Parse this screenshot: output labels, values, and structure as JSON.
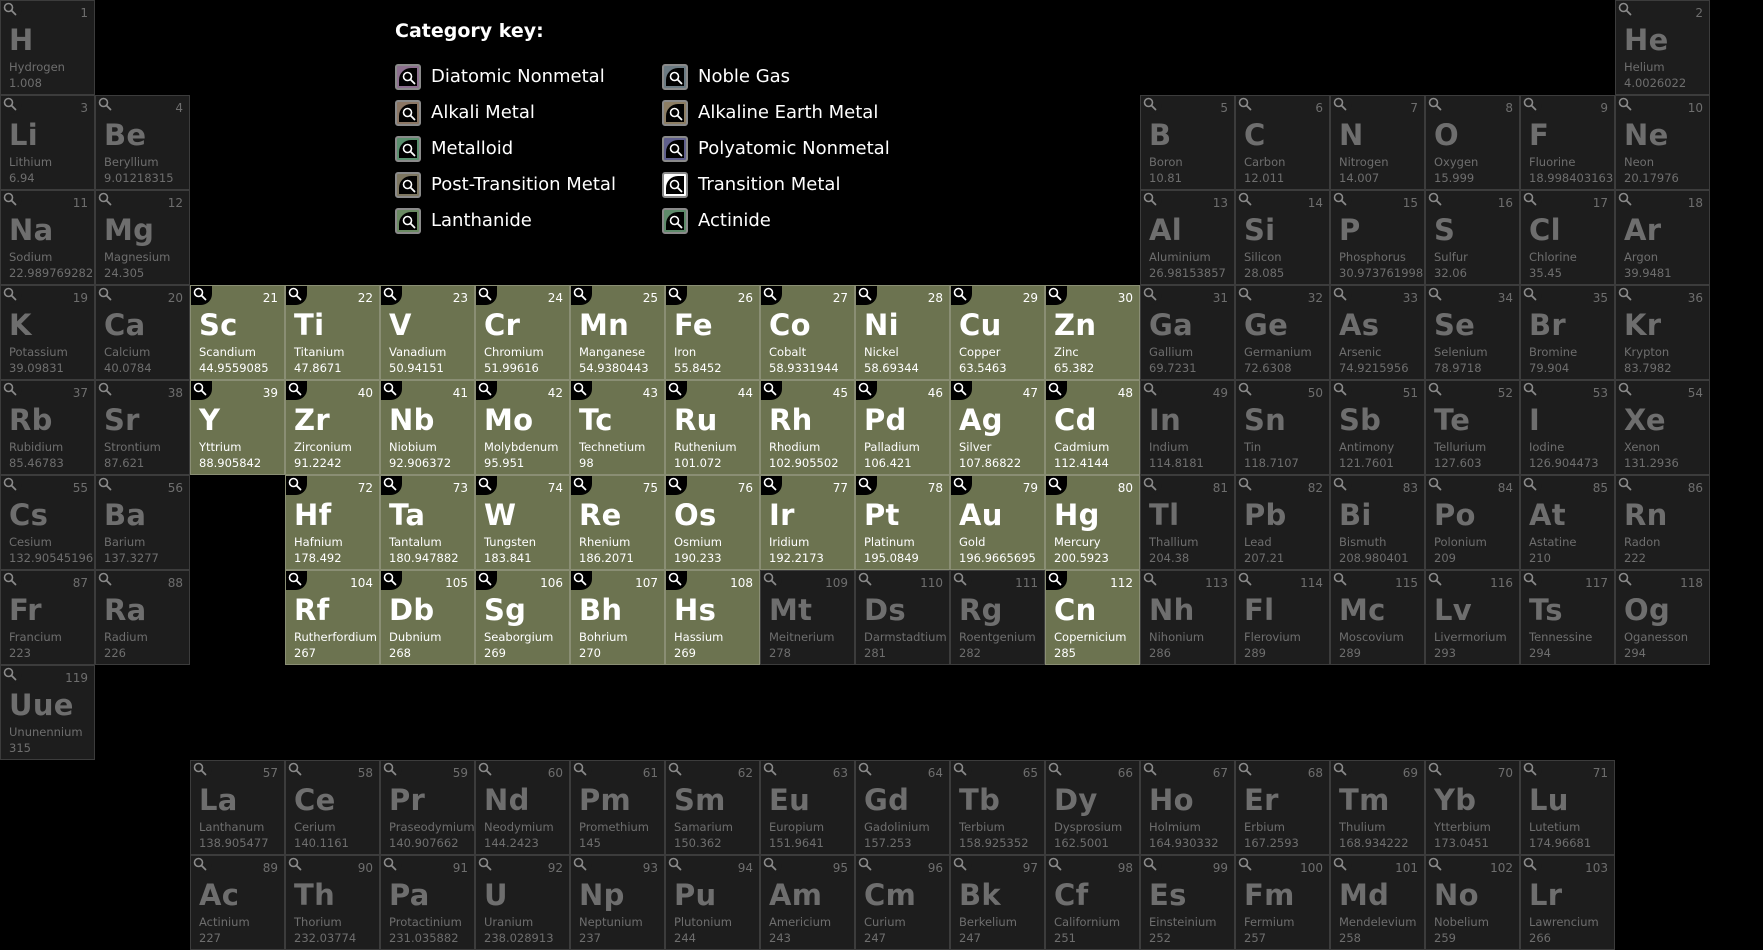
{
  "legend": {
    "title": "Category key:",
    "items": [
      {
        "label": "Diatomic Nonmetal",
        "color": "#8c6f8e"
      },
      {
        "label": "Noble Gas",
        "color": "#6b7a82"
      },
      {
        "label": "Alkali Metal",
        "color": "#8b7664"
      },
      {
        "label": "Alkaline Earth Metal",
        "color": "#8c7d63"
      },
      {
        "label": "Metalloid",
        "color": "#5a8f6e"
      },
      {
        "label": "Polyatomic Nonmetal",
        "color": "#5f5f8c"
      },
      {
        "label": "Post-Transition Metal",
        "color": "#7d7660"
      },
      {
        "label": "Transition Metal",
        "color": "#ffffff"
      },
      {
        "label": "Lanthanide",
        "color": "#6a8a62"
      },
      {
        "label": "Actinide",
        "color": "#5e8a6a"
      }
    ]
  },
  "colors": {
    "highlight_cell": "#6c7350",
    "dim_cell": "#1d1d1d",
    "dim_text": "#6e6e6e"
  },
  "icons": {
    "cell_corner": "magnifier-icon",
    "legend_box": "magnifier-icon"
  },
  "elements": [
    {
      "n": 1,
      "sym": "H",
      "name": "Hydrogen",
      "w": "1.008",
      "row": 1,
      "col": 1,
      "hl": false
    },
    {
      "n": 2,
      "sym": "He",
      "name": "Helium",
      "w": "4.0026022",
      "row": 1,
      "col": 18,
      "hl": false
    },
    {
      "n": 3,
      "sym": "Li",
      "name": "Lithium",
      "w": "6.94",
      "row": 2,
      "col": 1,
      "hl": false
    },
    {
      "n": 4,
      "sym": "Be",
      "name": "Beryllium",
      "w": "9.01218315",
      "row": 2,
      "col": 2,
      "hl": false
    },
    {
      "n": 5,
      "sym": "B",
      "name": "Boron",
      "w": "10.81",
      "row": 2,
      "col": 13,
      "hl": false
    },
    {
      "n": 6,
      "sym": "C",
      "name": "Carbon",
      "w": "12.011",
      "row": 2,
      "col": 14,
      "hl": false
    },
    {
      "n": 7,
      "sym": "N",
      "name": "Nitrogen",
      "w": "14.007",
      "row": 2,
      "col": 15,
      "hl": false
    },
    {
      "n": 8,
      "sym": "O",
      "name": "Oxygen",
      "w": "15.999",
      "row": 2,
      "col": 16,
      "hl": false
    },
    {
      "n": 9,
      "sym": "F",
      "name": "Fluorine",
      "w": "18.9984031636",
      "row": 2,
      "col": 17,
      "hl": false
    },
    {
      "n": 10,
      "sym": "Ne",
      "name": "Neon",
      "w": "20.17976",
      "row": 2,
      "col": 18,
      "hl": false
    },
    {
      "n": 11,
      "sym": "Na",
      "name": "Sodium",
      "w": "22.989769282",
      "row": 3,
      "col": 1,
      "hl": false
    },
    {
      "n": 12,
      "sym": "Mg",
      "name": "Magnesium",
      "w": "24.305",
      "row": 3,
      "col": 2,
      "hl": false
    },
    {
      "n": 13,
      "sym": "Al",
      "name": "Aluminium",
      "w": "26.98153857",
      "row": 3,
      "col": 13,
      "hl": false
    },
    {
      "n": 14,
      "sym": "Si",
      "name": "Silicon",
      "w": "28.085",
      "row": 3,
      "col": 14,
      "hl": false
    },
    {
      "n": 15,
      "sym": "P",
      "name": "Phosphorus",
      "w": "30.9737619985",
      "row": 3,
      "col": 15,
      "hl": false
    },
    {
      "n": 16,
      "sym": "S",
      "name": "Sulfur",
      "w": "32.06",
      "row": 3,
      "col": 16,
      "hl": false
    },
    {
      "n": 17,
      "sym": "Cl",
      "name": "Chlorine",
      "w": "35.45",
      "row": 3,
      "col": 17,
      "hl": false
    },
    {
      "n": 18,
      "sym": "Ar",
      "name": "Argon",
      "w": "39.9481",
      "row": 3,
      "col": 18,
      "hl": false
    },
    {
      "n": 19,
      "sym": "K",
      "name": "Potassium",
      "w": "39.09831",
      "row": 4,
      "col": 1,
      "hl": false
    },
    {
      "n": 20,
      "sym": "Ca",
      "name": "Calcium",
      "w": "40.0784",
      "row": 4,
      "col": 2,
      "hl": false
    },
    {
      "n": 21,
      "sym": "Sc",
      "name": "Scandium",
      "w": "44.9559085",
      "row": 4,
      "col": 3,
      "hl": true
    },
    {
      "n": 22,
      "sym": "Ti",
      "name": "Titanium",
      "w": "47.8671",
      "row": 4,
      "col": 4,
      "hl": true
    },
    {
      "n": 23,
      "sym": "V",
      "name": "Vanadium",
      "w": "50.94151",
      "row": 4,
      "col": 5,
      "hl": true
    },
    {
      "n": 24,
      "sym": "Cr",
      "name": "Chromium",
      "w": "51.99616",
      "row": 4,
      "col": 6,
      "hl": true
    },
    {
      "n": 25,
      "sym": "Mn",
      "name": "Manganese",
      "w": "54.9380443",
      "row": 4,
      "col": 7,
      "hl": true
    },
    {
      "n": 26,
      "sym": "Fe",
      "name": "Iron",
      "w": "55.8452",
      "row": 4,
      "col": 8,
      "hl": true
    },
    {
      "n": 27,
      "sym": "Co",
      "name": "Cobalt",
      "w": "58.9331944",
      "row": 4,
      "col": 9,
      "hl": true
    },
    {
      "n": 28,
      "sym": "Ni",
      "name": "Nickel",
      "w": "58.69344",
      "row": 4,
      "col": 10,
      "hl": true
    },
    {
      "n": 29,
      "sym": "Cu",
      "name": "Copper",
      "w": "63.5463",
      "row": 4,
      "col": 11,
      "hl": true
    },
    {
      "n": 30,
      "sym": "Zn",
      "name": "Zinc",
      "w": "65.382",
      "row": 4,
      "col": 12,
      "hl": true
    },
    {
      "n": 31,
      "sym": "Ga",
      "name": "Gallium",
      "w": "69.7231",
      "row": 4,
      "col": 13,
      "hl": false
    },
    {
      "n": 32,
      "sym": "Ge",
      "name": "Germanium",
      "w": "72.6308",
      "row": 4,
      "col": 14,
      "hl": false
    },
    {
      "n": 33,
      "sym": "As",
      "name": "Arsenic",
      "w": "74.9215956",
      "row": 4,
      "col": 15,
      "hl": false
    },
    {
      "n": 34,
      "sym": "Se",
      "name": "Selenium",
      "w": "78.9718",
      "row": 4,
      "col": 16,
      "hl": false
    },
    {
      "n": 35,
      "sym": "Br",
      "name": "Bromine",
      "w": "79.904",
      "row": 4,
      "col": 17,
      "hl": false
    },
    {
      "n": 36,
      "sym": "Kr",
      "name": "Krypton",
      "w": "83.7982",
      "row": 4,
      "col": 18,
      "hl": false
    },
    {
      "n": 37,
      "sym": "Rb",
      "name": "Rubidium",
      "w": "85.46783",
      "row": 5,
      "col": 1,
      "hl": false
    },
    {
      "n": 38,
      "sym": "Sr",
      "name": "Strontium",
      "w": "87.621",
      "row": 5,
      "col": 2,
      "hl": false
    },
    {
      "n": 39,
      "sym": "Y",
      "name": "Yttrium",
      "w": "88.905842",
      "row": 5,
      "col": 3,
      "hl": true
    },
    {
      "n": 40,
      "sym": "Zr",
      "name": "Zirconium",
      "w": "91.2242",
      "row": 5,
      "col": 4,
      "hl": true
    },
    {
      "n": 41,
      "sym": "Nb",
      "name": "Niobium",
      "w": "92.906372",
      "row": 5,
      "col": 5,
      "hl": true
    },
    {
      "n": 42,
      "sym": "Mo",
      "name": "Molybdenum",
      "w": "95.951",
      "row": 5,
      "col": 6,
      "hl": true
    },
    {
      "n": 43,
      "sym": "Tc",
      "name": "Technetium",
      "w": "98",
      "row": 5,
      "col": 7,
      "hl": true
    },
    {
      "n": 44,
      "sym": "Ru",
      "name": "Ruthenium",
      "w": "101.072",
      "row": 5,
      "col": 8,
      "hl": true
    },
    {
      "n": 45,
      "sym": "Rh",
      "name": "Rhodium",
      "w": "102.905502",
      "row": 5,
      "col": 9,
      "hl": true
    },
    {
      "n": 46,
      "sym": "Pd",
      "name": "Palladium",
      "w": "106.421",
      "row": 5,
      "col": 10,
      "hl": true
    },
    {
      "n": 47,
      "sym": "Ag",
      "name": "Silver",
      "w": "107.86822",
      "row": 5,
      "col": 11,
      "hl": true
    },
    {
      "n": 48,
      "sym": "Cd",
      "name": "Cadmium",
      "w": "112.4144",
      "row": 5,
      "col": 12,
      "hl": true
    },
    {
      "n": 49,
      "sym": "In",
      "name": "Indium",
      "w": "114.8181",
      "row": 5,
      "col": 13,
      "hl": false
    },
    {
      "n": 50,
      "sym": "Sn",
      "name": "Tin",
      "w": "118.7107",
      "row": 5,
      "col": 14,
      "hl": false
    },
    {
      "n": 51,
      "sym": "Sb",
      "name": "Antimony",
      "w": "121.7601",
      "row": 5,
      "col": 15,
      "hl": false
    },
    {
      "n": 52,
      "sym": "Te",
      "name": "Tellurium",
      "w": "127.603",
      "row": 5,
      "col": 16,
      "hl": false
    },
    {
      "n": 53,
      "sym": "I",
      "name": "Iodine",
      "w": "126.904473",
      "row": 5,
      "col": 17,
      "hl": false
    },
    {
      "n": 54,
      "sym": "Xe",
      "name": "Xenon",
      "w": "131.2936",
      "row": 5,
      "col": 18,
      "hl": false
    },
    {
      "n": 55,
      "sym": "Cs",
      "name": "Cesium",
      "w": "132.905451966",
      "row": 6,
      "col": 1,
      "hl": false
    },
    {
      "n": 56,
      "sym": "Ba",
      "name": "Barium",
      "w": "137.3277",
      "row": 6,
      "col": 2,
      "hl": false
    },
    {
      "n": 72,
      "sym": "Hf",
      "name": "Hafnium",
      "w": "178.492",
      "row": 6,
      "col": 4,
      "hl": true
    },
    {
      "n": 73,
      "sym": "Ta",
      "name": "Tantalum",
      "w": "180.947882",
      "row": 6,
      "col": 5,
      "hl": true
    },
    {
      "n": 74,
      "sym": "W",
      "name": "Tungsten",
      "w": "183.841",
      "row": 6,
      "col": 6,
      "hl": true
    },
    {
      "n": 75,
      "sym": "Re",
      "name": "Rhenium",
      "w": "186.2071",
      "row": 6,
      "col": 7,
      "hl": true
    },
    {
      "n": 76,
      "sym": "Os",
      "name": "Osmium",
      "w": "190.233",
      "row": 6,
      "col": 8,
      "hl": true
    },
    {
      "n": 77,
      "sym": "Ir",
      "name": "Iridium",
      "w": "192.2173",
      "row": 6,
      "col": 9,
      "hl": true
    },
    {
      "n": 78,
      "sym": "Pt",
      "name": "Platinum",
      "w": "195.0849",
      "row": 6,
      "col": 10,
      "hl": true
    },
    {
      "n": 79,
      "sym": "Au",
      "name": "Gold",
      "w": "196.9665695",
      "row": 6,
      "col": 11,
      "hl": true
    },
    {
      "n": 80,
      "sym": "Hg",
      "name": "Mercury",
      "w": "200.5923",
      "row": 6,
      "col": 12,
      "hl": true
    },
    {
      "n": 81,
      "sym": "Tl",
      "name": "Thallium",
      "w": "204.38",
      "row": 6,
      "col": 13,
      "hl": false
    },
    {
      "n": 82,
      "sym": "Pb",
      "name": "Lead",
      "w": "207.21",
      "row": 6,
      "col": 14,
      "hl": false
    },
    {
      "n": 83,
      "sym": "Bi",
      "name": "Bismuth",
      "w": "208.980401",
      "row": 6,
      "col": 15,
      "hl": false
    },
    {
      "n": 84,
      "sym": "Po",
      "name": "Polonium",
      "w": "209",
      "row": 6,
      "col": 16,
      "hl": false
    },
    {
      "n": 85,
      "sym": "At",
      "name": "Astatine",
      "w": "210",
      "row": 6,
      "col": 17,
      "hl": false
    },
    {
      "n": 86,
      "sym": "Rn",
      "name": "Radon",
      "w": "222",
      "row": 6,
      "col": 18,
      "hl": false
    },
    {
      "n": 87,
      "sym": "Fr",
      "name": "Francium",
      "w": "223",
      "row": 7,
      "col": 1,
      "hl": false
    },
    {
      "n": 88,
      "sym": "Ra",
      "name": "Radium",
      "w": "226",
      "row": 7,
      "col": 2,
      "hl": false
    },
    {
      "n": 104,
      "sym": "Rf",
      "name": "Rutherfordium",
      "w": "267",
      "row": 7,
      "col": 4,
      "hl": true
    },
    {
      "n": 105,
      "sym": "Db",
      "name": "Dubnium",
      "w": "268",
      "row": 7,
      "col": 5,
      "hl": true
    },
    {
      "n": 106,
      "sym": "Sg",
      "name": "Seaborgium",
      "w": "269",
      "row": 7,
      "col": 6,
      "hl": true
    },
    {
      "n": 107,
      "sym": "Bh",
      "name": "Bohrium",
      "w": "270",
      "row": 7,
      "col": 7,
      "hl": true
    },
    {
      "n": 108,
      "sym": "Hs",
      "name": "Hassium",
      "w": "269",
      "row": 7,
      "col": 8,
      "hl": true
    },
    {
      "n": 109,
      "sym": "Mt",
      "name": "Meitnerium",
      "w": "278",
      "row": 7,
      "col": 9,
      "hl": false
    },
    {
      "n": 110,
      "sym": "Ds",
      "name": "Darmstadtium",
      "w": "281",
      "row": 7,
      "col": 10,
      "hl": false
    },
    {
      "n": 111,
      "sym": "Rg",
      "name": "Roentgenium",
      "w": "282",
      "row": 7,
      "col": 11,
      "hl": false
    },
    {
      "n": 112,
      "sym": "Cn",
      "name": "Copernicium",
      "w": "285",
      "row": 7,
      "col": 12,
      "hl": true
    },
    {
      "n": 113,
      "sym": "Nh",
      "name": "Nihonium",
      "w": "286",
      "row": 7,
      "col": 13,
      "hl": false
    },
    {
      "n": 114,
      "sym": "Fl",
      "name": "Flerovium",
      "w": "289",
      "row": 7,
      "col": 14,
      "hl": false
    },
    {
      "n": 115,
      "sym": "Mc",
      "name": "Moscovium",
      "w": "289",
      "row": 7,
      "col": 15,
      "hl": false
    },
    {
      "n": 116,
      "sym": "Lv",
      "name": "Livermorium",
      "w": "293",
      "row": 7,
      "col": 16,
      "hl": false
    },
    {
      "n": 117,
      "sym": "Ts",
      "name": "Tennessine",
      "w": "294",
      "row": 7,
      "col": 17,
      "hl": false
    },
    {
      "n": 118,
      "sym": "Og",
      "name": "Oganesson",
      "w": "294",
      "row": 7,
      "col": 18,
      "hl": false
    },
    {
      "n": 119,
      "sym": "Uue",
      "name": "Ununennium",
      "w": "315",
      "row": 8,
      "col": 1,
      "hl": false
    },
    {
      "n": 57,
      "sym": "La",
      "name": "Lanthanum",
      "w": "138.905477",
      "row": 9,
      "col": 3,
      "hl": false
    },
    {
      "n": 58,
      "sym": "Ce",
      "name": "Cerium",
      "w": "140.1161",
      "row": 9,
      "col": 4,
      "hl": false
    },
    {
      "n": 59,
      "sym": "Pr",
      "name": "Praseodymium",
      "w": "140.907662",
      "row": 9,
      "col": 5,
      "hl": false
    },
    {
      "n": 60,
      "sym": "Nd",
      "name": "Neodymium",
      "w": "144.2423",
      "row": 9,
      "col": 6,
      "hl": false
    },
    {
      "n": 61,
      "sym": "Pm",
      "name": "Promethium",
      "w": "145",
      "row": 9,
      "col": 7,
      "hl": false
    },
    {
      "n": 62,
      "sym": "Sm",
      "name": "Samarium",
      "w": "150.362",
      "row": 9,
      "col": 8,
      "hl": false
    },
    {
      "n": 63,
      "sym": "Eu",
      "name": "Europium",
      "w": "151.9641",
      "row": 9,
      "col": 9,
      "hl": false
    },
    {
      "n": 64,
      "sym": "Gd",
      "name": "Gadolinium",
      "w": "157.253",
      "row": 9,
      "col": 10,
      "hl": false
    },
    {
      "n": 65,
      "sym": "Tb",
      "name": "Terbium",
      "w": "158.925352",
      "row": 9,
      "col": 11,
      "hl": false
    },
    {
      "n": 66,
      "sym": "Dy",
      "name": "Dysprosium",
      "w": "162.5001",
      "row": 9,
      "col": 12,
      "hl": false
    },
    {
      "n": 67,
      "sym": "Ho",
      "name": "Holmium",
      "w": "164.930332",
      "row": 9,
      "col": 13,
      "hl": false
    },
    {
      "n": 68,
      "sym": "Er",
      "name": "Erbium",
      "w": "167.2593",
      "row": 9,
      "col": 14,
      "hl": false
    },
    {
      "n": 69,
      "sym": "Tm",
      "name": "Thulium",
      "w": "168.934222",
      "row": 9,
      "col": 15,
      "hl": false
    },
    {
      "n": 70,
      "sym": "Yb",
      "name": "Ytterbium",
      "w": "173.0451",
      "row": 9,
      "col": 16,
      "hl": false
    },
    {
      "n": 71,
      "sym": "Lu",
      "name": "Lutetium",
      "w": "174.96681",
      "row": 9,
      "col": 17,
      "hl": false
    },
    {
      "n": 89,
      "sym": "Ac",
      "name": "Actinium",
      "w": "227",
      "row": 10,
      "col": 3,
      "hl": false
    },
    {
      "n": 90,
      "sym": "Th",
      "name": "Thorium",
      "w": "232.03774",
      "row": 10,
      "col": 4,
      "hl": false
    },
    {
      "n": 91,
      "sym": "Pa",
      "name": "Protactinium",
      "w": "231.035882",
      "row": 10,
      "col": 5,
      "hl": false
    },
    {
      "n": 92,
      "sym": "U",
      "name": "Uranium",
      "w": "238.028913",
      "row": 10,
      "col": 6,
      "hl": false
    },
    {
      "n": 93,
      "sym": "Np",
      "name": "Neptunium",
      "w": "237",
      "row": 10,
      "col": 7,
      "hl": false
    },
    {
      "n": 94,
      "sym": "Pu",
      "name": "Plutonium",
      "w": "244",
      "row": 10,
      "col": 8,
      "hl": false
    },
    {
      "n": 95,
      "sym": "Am",
      "name": "Americium",
      "w": "243",
      "row": 10,
      "col": 9,
      "hl": false
    },
    {
      "n": 96,
      "sym": "Cm",
      "name": "Curium",
      "w": "247",
      "row": 10,
      "col": 10,
      "hl": false
    },
    {
      "n": 97,
      "sym": "Bk",
      "name": "Berkelium",
      "w": "247",
      "row": 10,
      "col": 11,
      "hl": false
    },
    {
      "n": 98,
      "sym": "Cf",
      "name": "Californium",
      "w": "251",
      "row": 10,
      "col": 12,
      "hl": false
    },
    {
      "n": 99,
      "sym": "Es",
      "name": "Einsteinium",
      "w": "252",
      "row": 10,
      "col": 13,
      "hl": false
    },
    {
      "n": 100,
      "sym": "Fm",
      "name": "Fermium",
      "w": "257",
      "row": 10,
      "col": 14,
      "hl": false
    },
    {
      "n": 101,
      "sym": "Md",
      "name": "Mendelevium",
      "w": "258",
      "row": 10,
      "col": 15,
      "hl": false
    },
    {
      "n": 102,
      "sym": "No",
      "name": "Nobelium",
      "w": "259",
      "row": 10,
      "col": 16,
      "hl": false
    },
    {
      "n": 103,
      "sym": "Lr",
      "name": "Lawrencium",
      "w": "266",
      "row": 10,
      "col": 17,
      "hl": false
    }
  ]
}
